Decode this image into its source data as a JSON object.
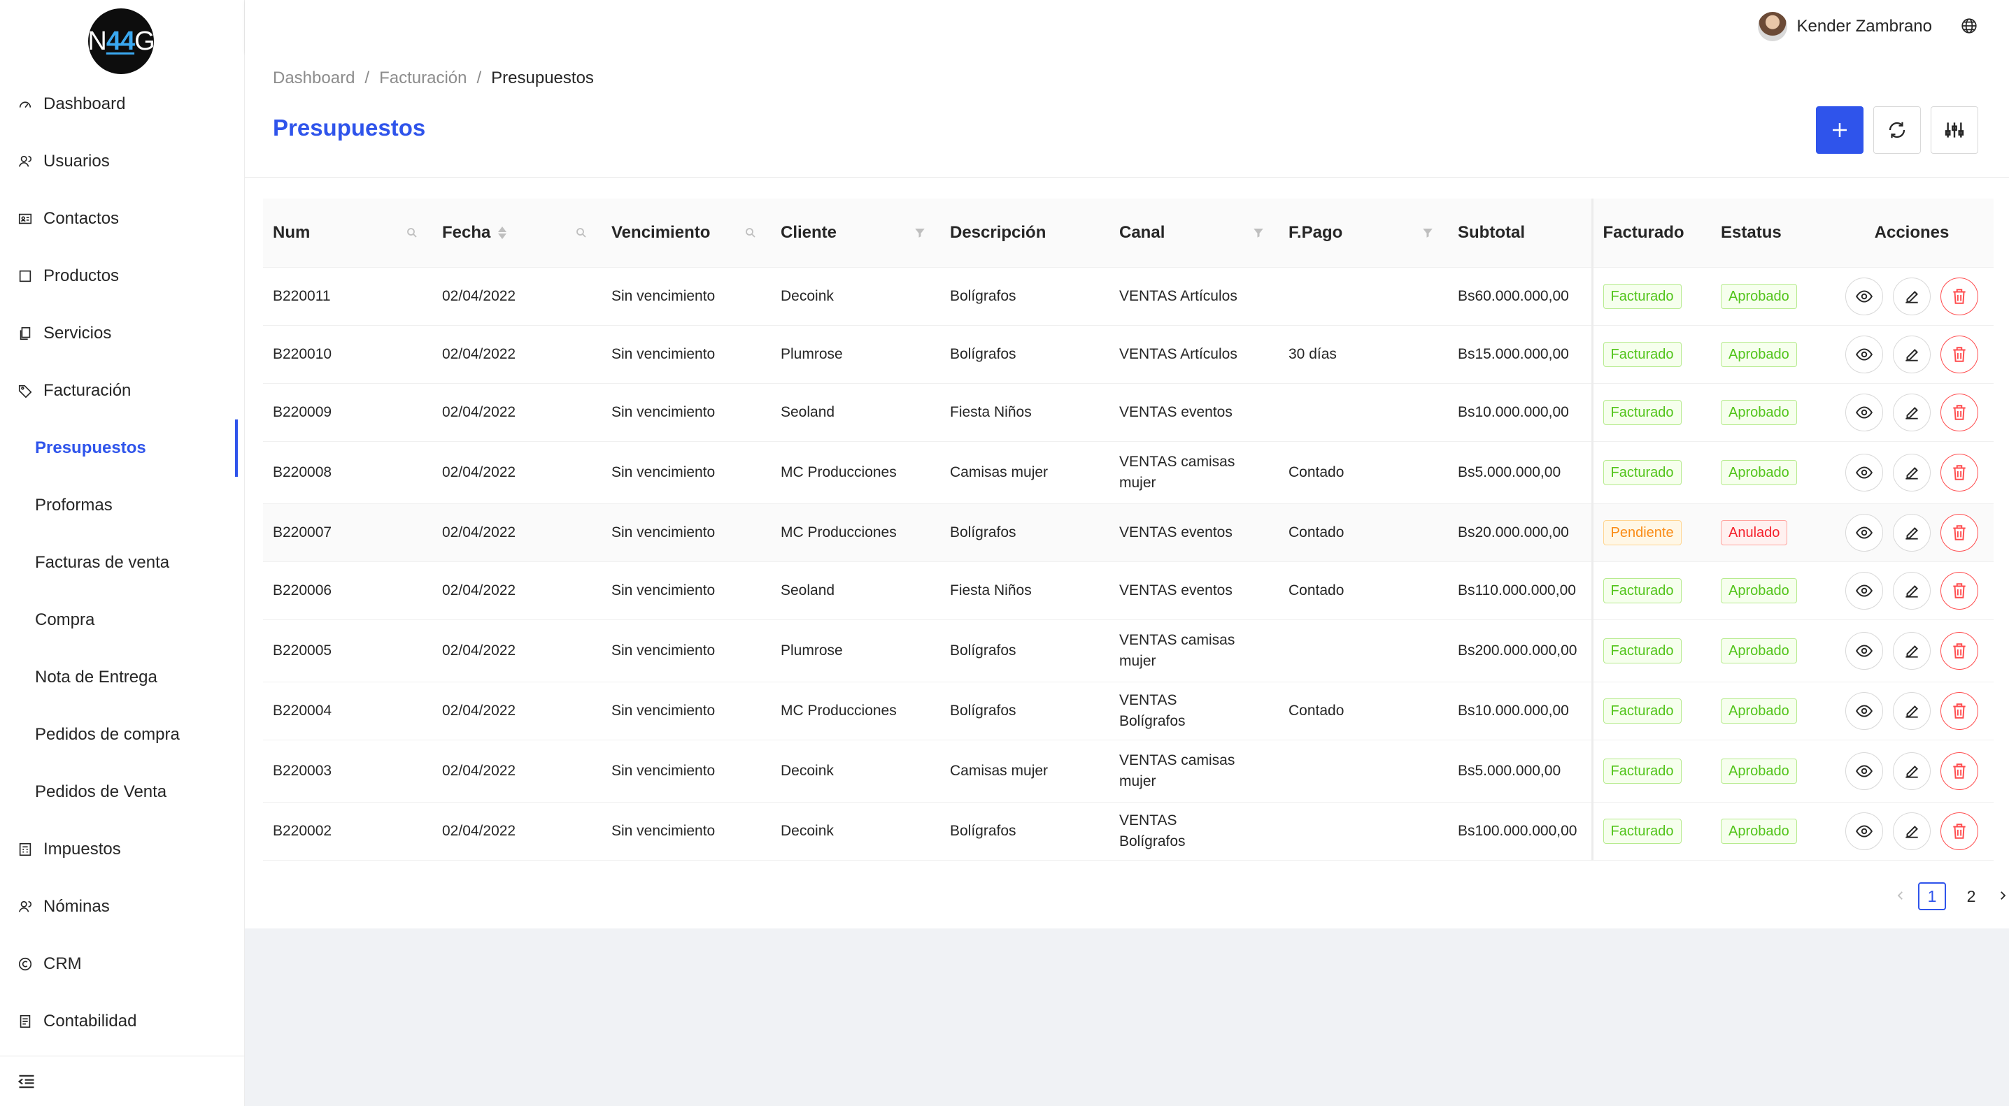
{
  "logo": {
    "text_a": "N",
    "text_b": "44",
    "text_c": "G"
  },
  "sidebar": {
    "items": [
      {
        "label": "Dashboard",
        "icon": "dashboard-icon"
      },
      {
        "label": "Usuarios",
        "icon": "users-icon"
      },
      {
        "label": "Contactos",
        "icon": "contacts-icon"
      },
      {
        "label": "Productos",
        "icon": "box-icon"
      },
      {
        "label": "Servicios",
        "icon": "file-copy-icon"
      },
      {
        "label": "Facturación",
        "icon": "tag-icon"
      },
      {
        "label": "Presupuestos",
        "sub": true,
        "active": true
      },
      {
        "label": "Proformas",
        "sub": true
      },
      {
        "label": "Facturas de venta",
        "sub": true
      },
      {
        "label": "Compra",
        "sub": true
      },
      {
        "label": "Nota de Entrega",
        "sub": true
      },
      {
        "label": "Pedidos de compra",
        "sub": true
      },
      {
        "label": "Pedidos de Venta",
        "sub": true
      },
      {
        "label": "Impuestos",
        "icon": "calculator-icon"
      },
      {
        "label": "Nóminas",
        "icon": "payroll-icon"
      },
      {
        "label": "CRM",
        "icon": "copyright-icon"
      },
      {
        "label": "Contabilidad",
        "icon": "ledger-icon"
      }
    ]
  },
  "header": {
    "user_name": "Kender Zambrano"
  },
  "breadcrumb": {
    "level1": "Dashboard",
    "level2": "Facturación",
    "level3": "Presupuestos",
    "separator": "/"
  },
  "page": {
    "title": "Presupuestos"
  },
  "table": {
    "columns": {
      "num": "Num",
      "fecha": "Fecha",
      "vencimiento": "Vencimiento",
      "cliente": "Cliente",
      "descripcion": "Descripción",
      "canal": "Canal",
      "fpago": "F.Pago",
      "subtotal": "Subtotal",
      "facturado": "Facturado",
      "estatus": "Estatus",
      "acciones": "Acciones"
    },
    "rows": [
      {
        "num": "B220011",
        "fecha": "02/04/2022",
        "vencimiento": "Sin vencimiento",
        "cliente": "Decoink",
        "descripcion": "Bolígrafos",
        "canal": "VENTAS Artículos",
        "fpago": "",
        "subtotal": "Bs60.000.000,00",
        "facturado": "Facturado",
        "estatus": "Aprobado"
      },
      {
        "num": "B220010",
        "fecha": "02/04/2022",
        "vencimiento": "Sin vencimiento",
        "cliente": "Plumrose",
        "descripcion": "Bolígrafos",
        "canal": "VENTAS Artículos",
        "fpago": "30 días",
        "subtotal": "Bs15.000.000,00",
        "facturado": "Facturado",
        "estatus": "Aprobado"
      },
      {
        "num": "B220009",
        "fecha": "02/04/2022",
        "vencimiento": "Sin vencimiento",
        "cliente": "Seoland",
        "descripcion": "Fiesta Niños",
        "canal": "VENTAS eventos",
        "fpago": "",
        "subtotal": "Bs10.000.000,00",
        "facturado": "Facturado",
        "estatus": "Aprobado"
      },
      {
        "num": "B220008",
        "fecha": "02/04/2022",
        "vencimiento": "Sin vencimiento",
        "cliente": "MC Producciones",
        "descripcion": "Camisas mujer",
        "canal": "VENTAS camisas mujer",
        "fpago": "Contado",
        "subtotal": "Bs5.000.000,00",
        "facturado": "Facturado",
        "estatus": "Aprobado"
      },
      {
        "num": "B220007",
        "fecha": "02/04/2022",
        "vencimiento": "Sin vencimiento",
        "cliente": "MC Producciones",
        "descripcion": "Bolígrafos",
        "canal": "VENTAS eventos",
        "fpago": "Contado",
        "subtotal": "Bs20.000.000,00",
        "facturado": "Pendiente",
        "estatus": "Anulado"
      },
      {
        "num": "B220006",
        "fecha": "02/04/2022",
        "vencimiento": "Sin vencimiento",
        "cliente": "Seoland",
        "descripcion": "Fiesta Niños",
        "canal": "VENTAS eventos",
        "fpago": "Contado",
        "subtotal": "Bs110.000.000,00",
        "facturado": "Facturado",
        "estatus": "Aprobado"
      },
      {
        "num": "B220005",
        "fecha": "02/04/2022",
        "vencimiento": "Sin vencimiento",
        "cliente": "Plumrose",
        "descripcion": "Bolígrafos",
        "canal": "VENTAS camisas mujer",
        "fpago": "",
        "subtotal": "Bs200.000.000,00",
        "facturado": "Facturado",
        "estatus": "Aprobado"
      },
      {
        "num": "B220004",
        "fecha": "02/04/2022",
        "vencimiento": "Sin vencimiento",
        "cliente": "MC Producciones",
        "descripcion": "Bolígrafos",
        "canal": "VENTAS Bolígrafos",
        "fpago": "Contado",
        "subtotal": "Bs10.000.000,00",
        "facturado": "Facturado",
        "estatus": "Aprobado"
      },
      {
        "num": "B220003",
        "fecha": "02/04/2022",
        "vencimiento": "Sin vencimiento",
        "cliente": "Decoink",
        "descripcion": "Camisas mujer",
        "canal": "VENTAS camisas mujer",
        "fpago": "",
        "subtotal": "Bs5.000.000,00",
        "facturado": "Facturado",
        "estatus": "Aprobado"
      },
      {
        "num": "B220002",
        "fecha": "02/04/2022",
        "vencimiento": "Sin vencimiento",
        "cliente": "Decoink",
        "descripcion": "Bolígrafos",
        "canal": "VENTAS Bolígrafos",
        "fpago": "",
        "subtotal": "Bs100.000.000,00",
        "facturado": "Facturado",
        "estatus": "Aprobado"
      }
    ]
  },
  "pagination": {
    "pages": [
      "1",
      "2"
    ],
    "current": "1"
  },
  "colors": {
    "primary": "#2f54eb",
    "success": "#52c41a",
    "warning": "#fa8c16",
    "danger": "#f5222d"
  }
}
